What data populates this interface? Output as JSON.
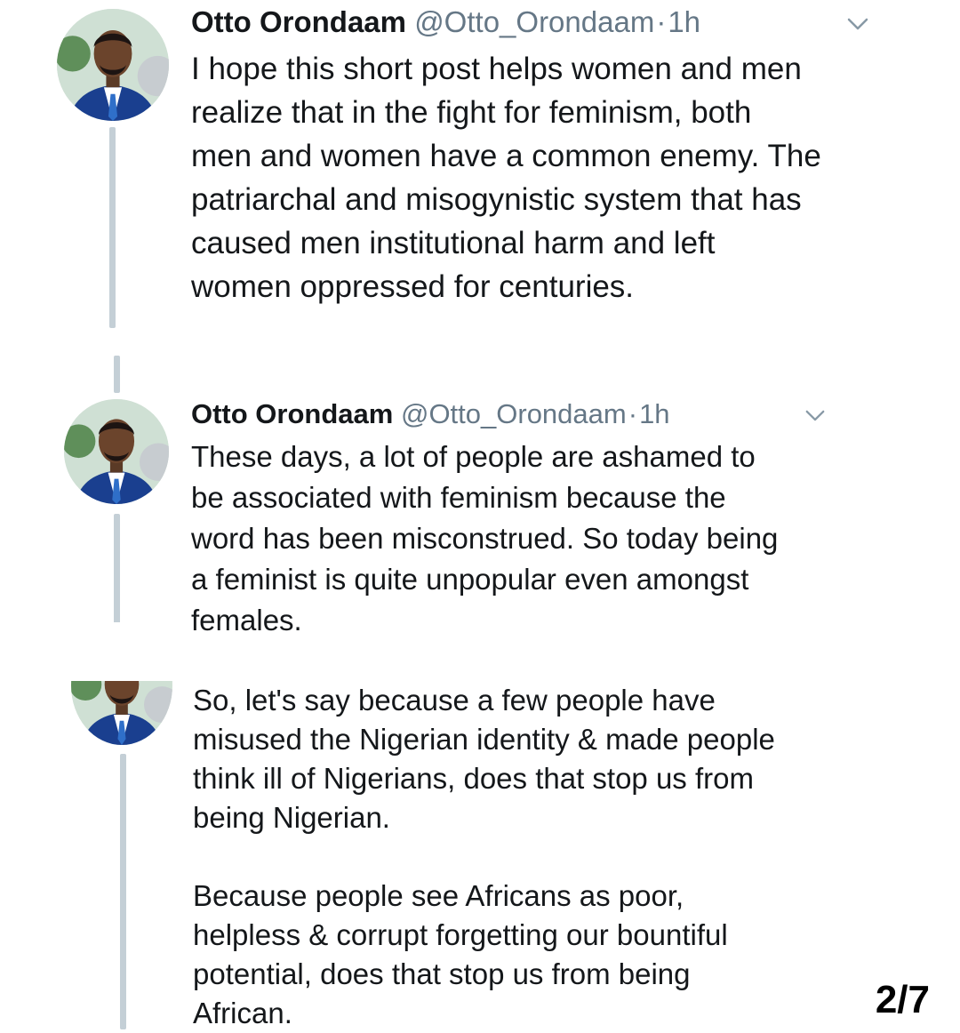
{
  "colors": {
    "text": "#14171a",
    "secondary_text": "#657786",
    "thread_line": "#c4cfd6",
    "suit": "#1a3f8f",
    "background": "#ffffff"
  },
  "tweets": [
    {
      "author": "Otto Orondaam",
      "handle": "@Otto_Orondaam",
      "separator": "·",
      "time": "1h",
      "menu_icon": "chevron-down-icon",
      "lines": [
        "I hope this short post helps women and men",
        "realize that in the fight for feminism, both",
        "men and women have a common enemy. The",
        "patriarchal and misogynistic system that has",
        "caused men institutional harm and left",
        "women oppressed for centuries."
      ]
    },
    {
      "author": "Otto Orondaam",
      "handle": "@Otto_Orondaam",
      "separator": "·",
      "time": "1h",
      "menu_icon": "chevron-down-icon",
      "lines": [
        "These days, a lot of people are ashamed to",
        "be associated with feminism because the",
        "word has been misconstrued. So today being",
        "a feminist is quite unpopular even amongst",
        "females."
      ]
    },
    {
      "lines": [
        "So, let's say because a few people have",
        "misused the Nigerian identity & made people",
        "think ill of Nigerians, does that stop us from",
        "being Nigerian."
      ],
      "lines2": [
        "Because people see Africans as poor,",
        "helpless & corrupt forgetting our bountiful",
        "potential, does that stop us from being",
        "African."
      ]
    }
  ],
  "page_indicator": "2/7"
}
